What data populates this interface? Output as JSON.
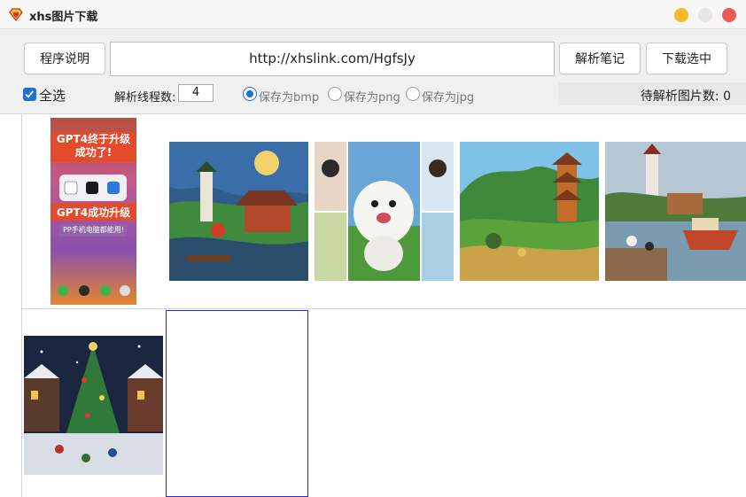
{
  "window": {
    "title": "xhs图片下载",
    "app_icon": "diamond-heart-icon",
    "controls": [
      "minimize-button",
      "maximize-button",
      "close-button"
    ],
    "colors": {
      "minimize": "#f6b92e",
      "maximize": "#e6e6e6",
      "close": "#ee5a52"
    }
  },
  "toolbar": {
    "help_label": "程序说明",
    "url_value": "http://xhslink.com/HgfsJy",
    "parse_label": "解析笔记",
    "download_label": "下载选中"
  },
  "options": {
    "select_all_label": "全选",
    "select_all_checked": true,
    "threads_label": "解析线程数:",
    "threads_value": "4",
    "formats": [
      {
        "label": "保存为bmp",
        "selected": true
      },
      {
        "label": "保存为png",
        "selected": false
      },
      {
        "label": "保存为jpg",
        "selected": false
      }
    ],
    "pending_label": "待解析图片数:",
    "pending_count": "0",
    "accent_color": "#1e6fd9"
  },
  "thumbnails": {
    "phone_poster": {
      "headline": "GPT4终于升级成功了!",
      "headline_line1": "GPT4终于升级",
      "headline_line2": "成功了!",
      "banner": "GPT4成功升级",
      "caption": "PP手机电脑都能用!"
    },
    "items": [
      "pagoda-village-painting",
      "white-dog-comic",
      "green-pagoda-landscape",
      "lighthouse-harbor-boat",
      "christmas-tree-village"
    ]
  }
}
